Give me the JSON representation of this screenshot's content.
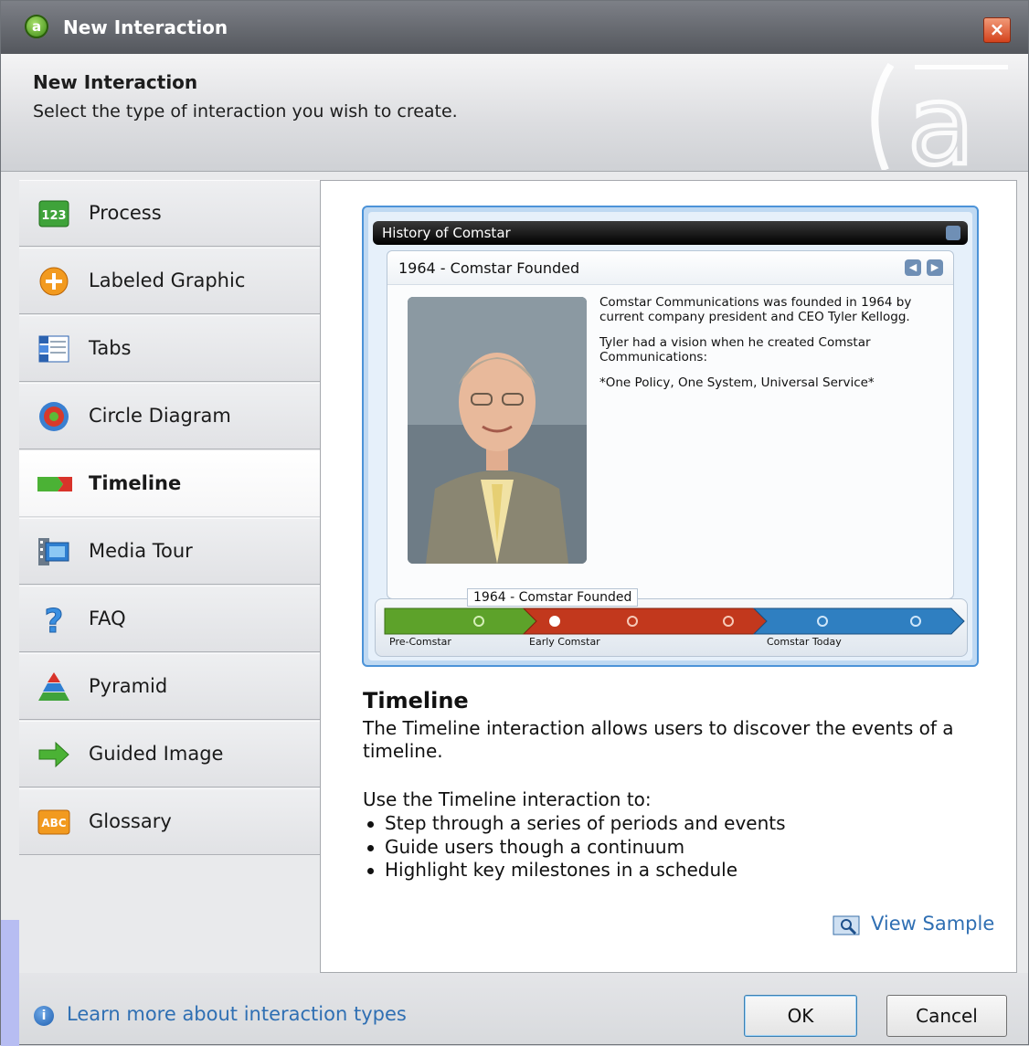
{
  "window": {
    "title": "New Interaction",
    "close_glyph": "×"
  },
  "header": {
    "title": "New Interaction",
    "subtitle": "Select the type of interaction you wish to create."
  },
  "sidebar": {
    "items": [
      {
        "label": "Process",
        "icon": "process-123-icon"
      },
      {
        "label": "Labeled Graphic",
        "icon": "labeled-graphic-plus-icon"
      },
      {
        "label": "Tabs",
        "icon": "tabs-icon"
      },
      {
        "label": "Circle Diagram",
        "icon": "circle-diagram-icon"
      },
      {
        "label": "Timeline",
        "icon": "timeline-arrows-icon",
        "selected": true
      },
      {
        "label": "Media Tour",
        "icon": "media-tour-filmstrip-icon"
      },
      {
        "label": "FAQ",
        "icon": "question-mark-icon"
      },
      {
        "label": "Pyramid",
        "icon": "pyramid-icon"
      },
      {
        "label": "Guided Image",
        "icon": "green-arrow-icon"
      },
      {
        "label": "Glossary",
        "icon": "abc-glossary-icon"
      }
    ]
  },
  "preview": {
    "window_title": "History of Comstar",
    "event_title": "1964 - Comstar Founded",
    "paragraphs": [
      "Comstar Communications was founded in 1964 by current company president and CEO Tyler Kellogg.",
      "Tyler had a vision when he created Comstar Communications:",
      "*One Policy, One System, Universal Service*"
    ],
    "timeline_tooltip": "1964 - Comstar Founded",
    "timeline_labels": [
      "Pre-Comstar",
      "Early Comstar",
      "Comstar Today"
    ]
  },
  "description": {
    "title": "Timeline",
    "body": "The Timeline interaction allows users to discover the events of a timeline.",
    "use_intro": "Use the Timeline interaction to:",
    "bullets": [
      "Step through a series of periods and events",
      "Guide users though a continuum",
      "Highlight key milestones in a schedule"
    ],
    "view_sample": "View Sample"
  },
  "footer": {
    "learn_more": "Learn more about interaction types",
    "ok_label": "OK",
    "cancel_label": "Cancel"
  },
  "colors": {
    "link": "#2f6fb3",
    "title_bar": "#6b6e74",
    "close_button": "#d4421c",
    "timeline_green": "#5da22a",
    "timeline_red": "#c2381d",
    "timeline_blue": "#2f7fc1"
  }
}
